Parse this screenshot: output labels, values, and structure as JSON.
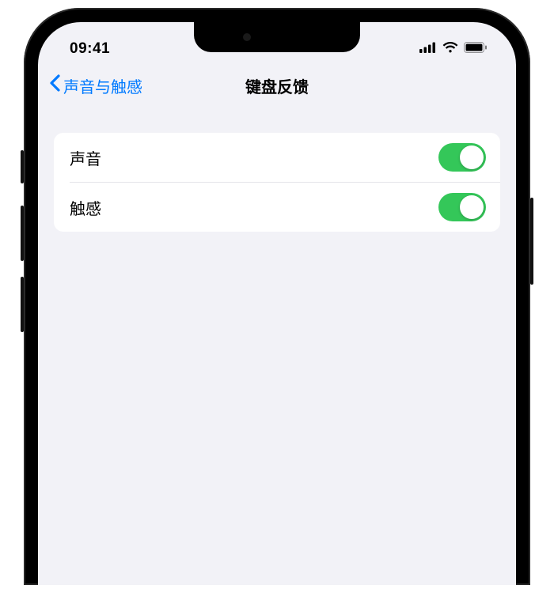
{
  "status": {
    "time": "09:41"
  },
  "nav": {
    "back_label": "声音与触感",
    "title": "键盘反馈"
  },
  "settings": {
    "rows": [
      {
        "label": "声音",
        "on": true
      },
      {
        "label": "触感",
        "on": true
      }
    ]
  },
  "colors": {
    "accent": "#007aff",
    "toggle_on": "#34c759",
    "bg": "#f2f2f7"
  }
}
